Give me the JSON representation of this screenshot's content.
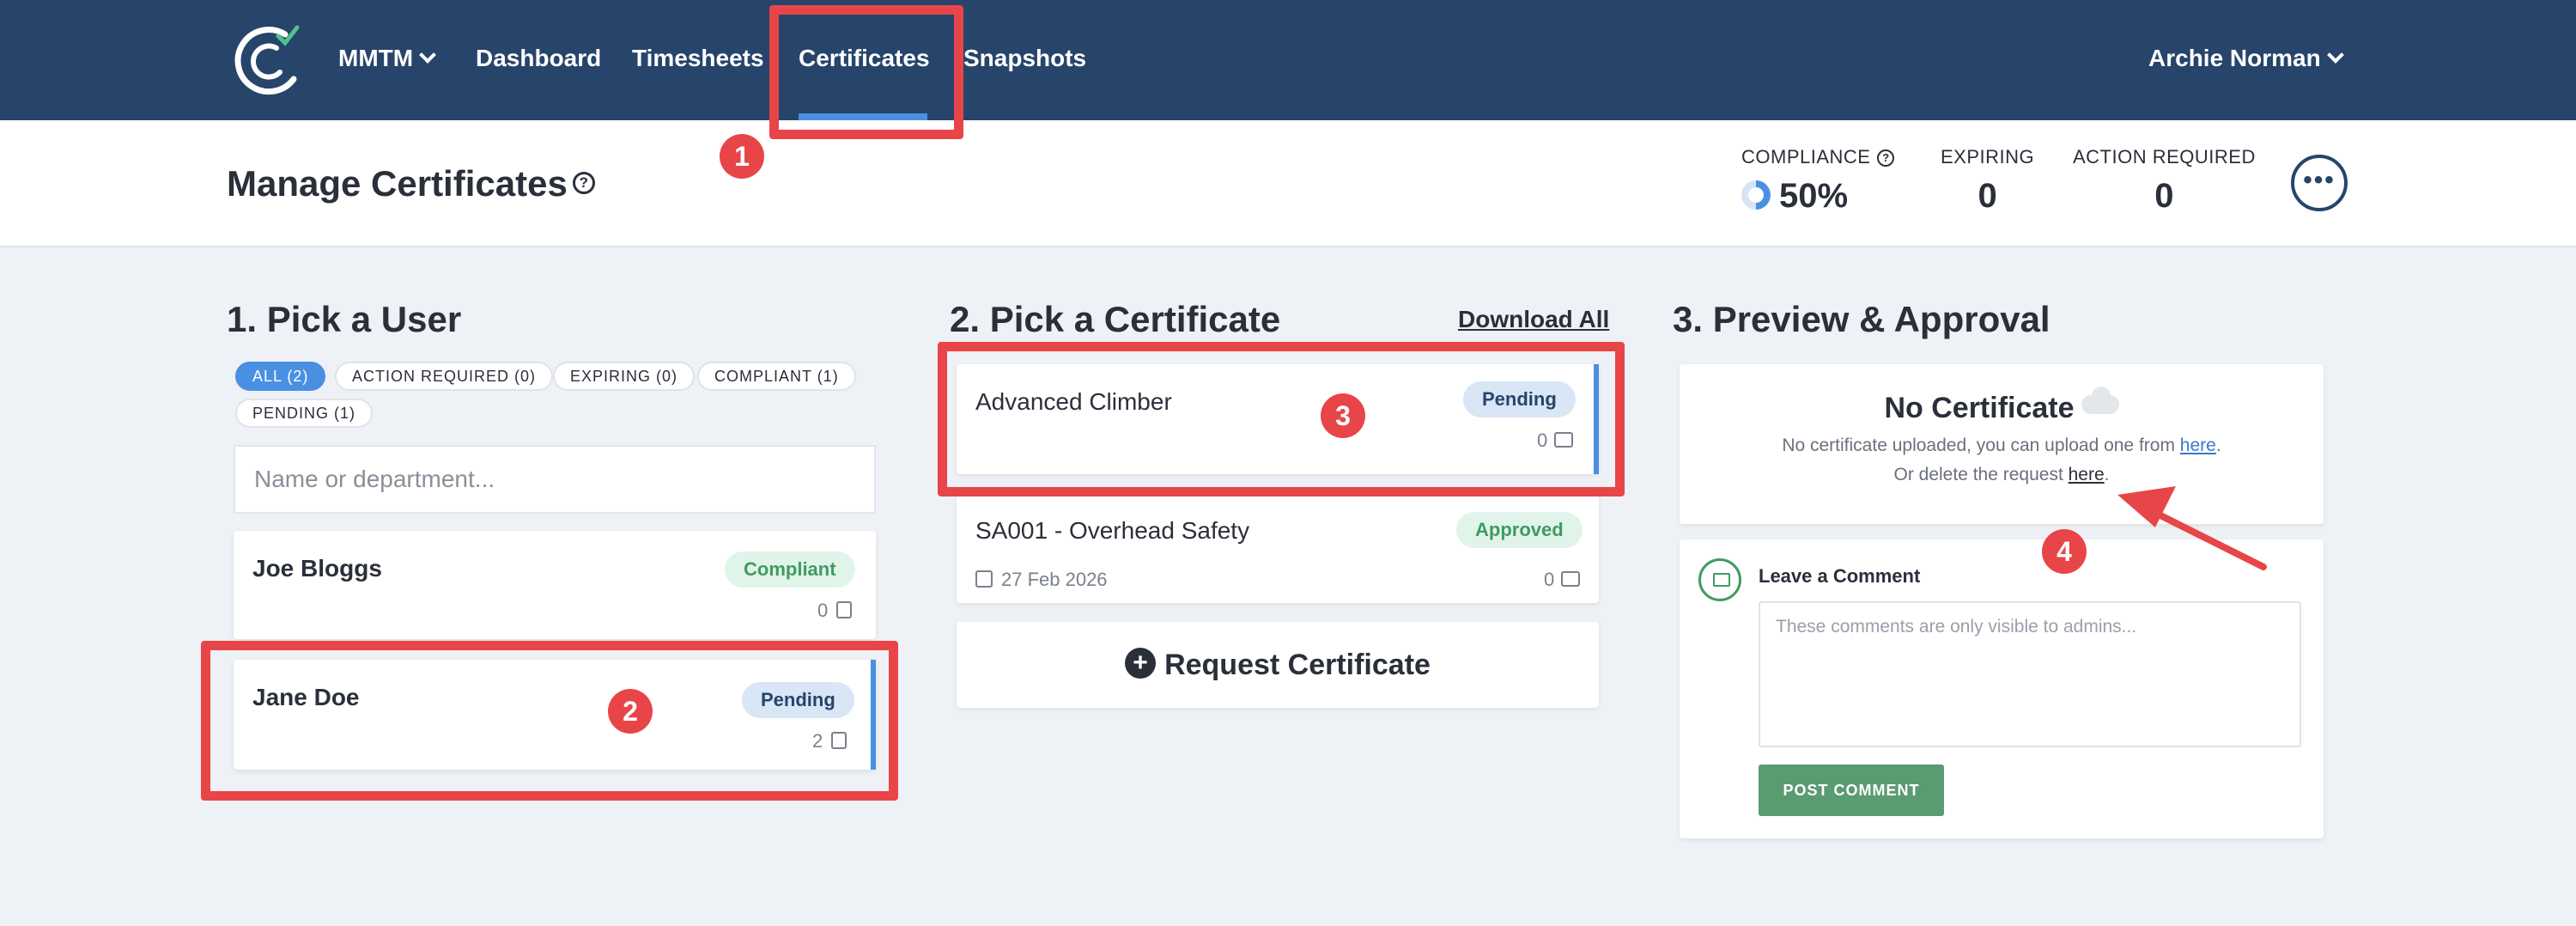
{
  "nav": {
    "org": "MMTM",
    "items": [
      "Dashboard",
      "Timesheets",
      "Certificates",
      "Snapshots"
    ],
    "user": "Archie Norman"
  },
  "header": {
    "title": "Manage Certificates",
    "stats": {
      "compliance_label": "COMPLIANCE",
      "compliance_value": "50%",
      "expiring_label": "EXPIRING",
      "expiring_value": "0",
      "action_label": "ACTION REQUIRED",
      "action_value": "0"
    },
    "more": "•••"
  },
  "users": {
    "title": "1. Pick a User",
    "filters": [
      "ALL (2)",
      "ACTION REQUIRED (0)",
      "EXPIRING (0)",
      "COMPLIANT (1)",
      "PENDING (1)"
    ],
    "search_placeholder": "Name or department...",
    "list": [
      {
        "name": "Joe Bloggs",
        "status": "Compliant",
        "count": "0"
      },
      {
        "name": "Jane Doe",
        "status": "Pending",
        "count": "2"
      }
    ]
  },
  "certs": {
    "title": "2. Pick a Certificate",
    "download_all": "Download All",
    "list": [
      {
        "name": "Advanced Climber",
        "status": "Pending",
        "count": "0"
      },
      {
        "name": "SA001 - Overhead Safety",
        "status": "Approved",
        "count": "0",
        "date": "27 Feb 2026"
      }
    ],
    "request_button": "Request Certificate"
  },
  "preview": {
    "title": "3. Preview & Approval",
    "no_cert": "No Certificate",
    "line1_text": "No certificate uploaded, you can upload one from ",
    "line1_link": "here",
    "line1_end": ".",
    "line2_text": "Or delete the request ",
    "line2_link": "here",
    "line2_end": ".",
    "comment_label": "Leave a Comment",
    "comment_placeholder": "These comments are only visible to admins...",
    "post_button": "POST COMMENT"
  },
  "annotations": [
    "1",
    "2",
    "3",
    "4"
  ],
  "colors": {
    "nav_bg": "#27446b",
    "accent": "#4a90e2",
    "annotation": "#e84549",
    "compliant": "#3f9b62"
  }
}
